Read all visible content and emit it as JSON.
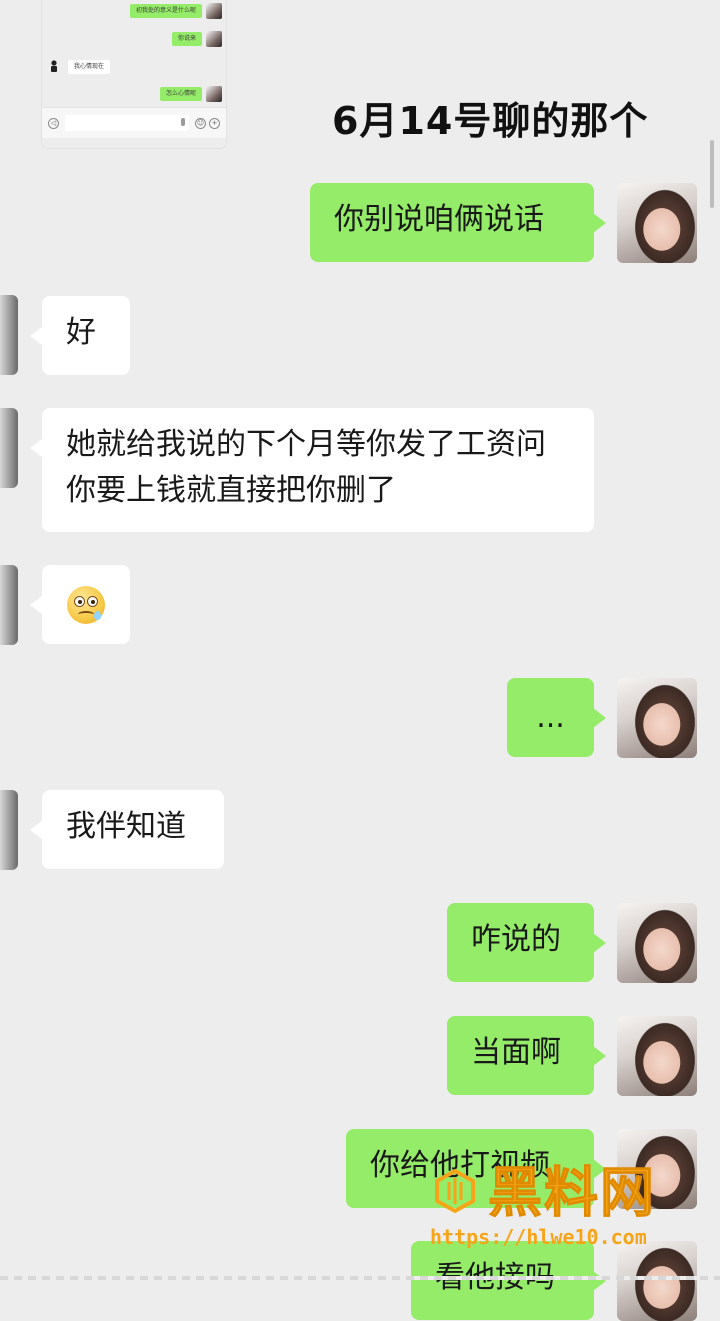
{
  "title": "6月14号聊的那个",
  "thumbnail": {
    "messages": [
      {
        "side": "out",
        "text": "初我处的意义是什么呢"
      },
      {
        "side": "out",
        "text": "你说来"
      },
      {
        "side": "in",
        "text": "我心情现在"
      },
      {
        "side": "out",
        "text": "怎么心情呢"
      }
    ]
  },
  "messages": [
    {
      "side": "out",
      "text": "你别说咱俩说话"
    },
    {
      "side": "in",
      "text": "好"
    },
    {
      "side": "in",
      "text": "她就给我说的下个月等你发了工资问你要上钱就直接把你删了"
    },
    {
      "side": "in",
      "type": "emoji",
      "icon": "woozy-face-emoji"
    },
    {
      "side": "out",
      "text": "..."
    },
    {
      "side": "in",
      "text": "我伴知道"
    },
    {
      "side": "out",
      "text": "咋说的"
    },
    {
      "side": "out",
      "text": "当面啊"
    },
    {
      "side": "out",
      "text": "你给他打视频"
    },
    {
      "side": "out",
      "text": "看他接吗"
    }
  ],
  "watermark": {
    "name": "黑料网",
    "url": "https://hlwe10.com"
  },
  "colors": {
    "background": "#ededed",
    "outgoing_bubble": "#95ec69",
    "incoming_bubble": "#ffffff",
    "watermark": "#f6a51a"
  }
}
